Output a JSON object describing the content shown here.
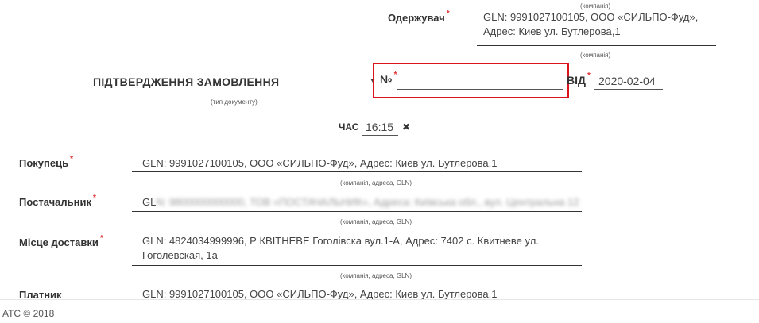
{
  "receiver": {
    "label": "Одержувач",
    "hint_top": "(компанія)",
    "line1": "GLN: 9991027100105, ООО «СИЛЬПО-Фуд»,",
    "line2": "Адрес: Киев ул. Бутлерова,1",
    "hint_bottom": "(компанія)"
  },
  "document": {
    "type_value": "ПІДТВЕРДЖЕННЯ ЗАМОВЛЕННЯ",
    "type_hint": "(тип документу)",
    "number_label": "№",
    "number_value": "",
    "date_label": "ВІД",
    "date_value": "2020-02-04",
    "time_label": "ЧАС",
    "time_value": "16:15",
    "clear_symbol": "✖"
  },
  "buyer": {
    "label": "Покупець",
    "value": "GLN: 9991027100105, ООО «СИЛЬПО-Фуд», Адрес: Киев ул. Бутлерова,1",
    "hint": "(компанія, адреса, GLN)"
  },
  "supplier": {
    "label": "Постачальник",
    "value_visible": "GL",
    "value_obscured": "N: 9800000000000, ТОВ «ПОСТАЧАЛЬНИК», Адреса: Київська обл., вул. Центральна 12",
    "hint": "(компанія, адреса, GLN)"
  },
  "delivery": {
    "label": "Місце доставки",
    "line1": "GLN: 4824034999996, Р КВІТНЕВЕ Гоголівска вул.1-А, Адрес: 7402 с. Квитневе ул.",
    "line2": "Гоголевская, 1а",
    "hint": "(компанія, адреса, GLN)"
  },
  "payer": {
    "label": "Платник",
    "value": "GLN: 9991027100105, ООО «СИЛЬПО-Фуд», Адрес: Киев ул. Бутлерова,1"
  },
  "footer": {
    "copyright": "АТС © 2018"
  },
  "colors": {
    "highlight_border": "#d9141b",
    "required_mark": "#e03131"
  }
}
